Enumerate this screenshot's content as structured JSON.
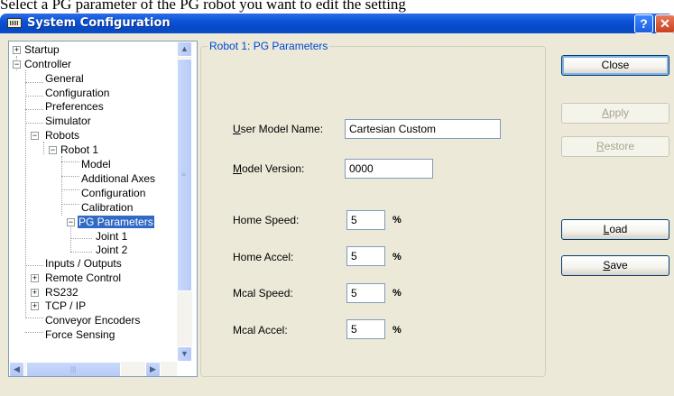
{
  "caption": "Select a PG parameter of the PG robot you want to edit the setting",
  "window": {
    "title": "System Configuration",
    "help_glyph": "?",
    "close_glyph": "✕"
  },
  "tree": {
    "items": [
      {
        "label": "Startup",
        "expander": "+"
      },
      {
        "label": "Controller",
        "expander": "−"
      },
      {
        "label": "General"
      },
      {
        "label": "Configuration"
      },
      {
        "label": "Preferences"
      },
      {
        "label": "Simulator"
      },
      {
        "label": "Robots",
        "expander": "−"
      },
      {
        "label": "Robot 1",
        "expander": "−"
      },
      {
        "label": "Model"
      },
      {
        "label": "Additional Axes"
      },
      {
        "label": "Configuration"
      },
      {
        "label": "Calibration"
      },
      {
        "label": "PG Parameters",
        "expander": "−",
        "selected": true
      },
      {
        "label": "Joint 1"
      },
      {
        "label": "Joint 2"
      },
      {
        "label": "Inputs / Outputs"
      },
      {
        "label": "Remote Control",
        "expander": "+"
      },
      {
        "label": "RS232",
        "expander": "+"
      },
      {
        "label": "TCP / IP",
        "expander": "+"
      },
      {
        "label": "Conveyor Encoders"
      },
      {
        "label": "Force Sensing"
      }
    ],
    "scroll_up": "▲",
    "scroll_down": "▼",
    "scroll_left": "◀",
    "scroll_right": "▶"
  },
  "group": {
    "title": "Robot 1: PG Parameters",
    "user_model_name": {
      "label_hot": "U",
      "label_rest": "ser Model Name:",
      "value": "Cartesian Custom"
    },
    "model_version": {
      "label_hot": "M",
      "label_rest": "odel Version:",
      "value": "0000"
    },
    "home_speed": {
      "label": "Home Speed:",
      "value": "5",
      "unit": "%"
    },
    "home_accel": {
      "label": "Home Accel:",
      "value": "5",
      "unit": "%"
    },
    "mcal_speed": {
      "label": "Mcal Speed:",
      "value": "5",
      "unit": "%"
    },
    "mcal_accel": {
      "label": "Mcal Accel:",
      "value": "5",
      "unit": "%"
    }
  },
  "buttons": {
    "close": "Close",
    "apply": {
      "hot": "A",
      "rest": "pply"
    },
    "restore": {
      "hot": "R",
      "rest": "estore"
    },
    "load": {
      "hot": "L",
      "rest": "oad"
    },
    "save": {
      "hot": "S",
      "rest": "ave"
    }
  },
  "colors": {
    "titlebar": "#0a52d6",
    "dialog_bg": "#ece9d8",
    "selection": "#316ac5",
    "group_title": "#0046d5"
  }
}
